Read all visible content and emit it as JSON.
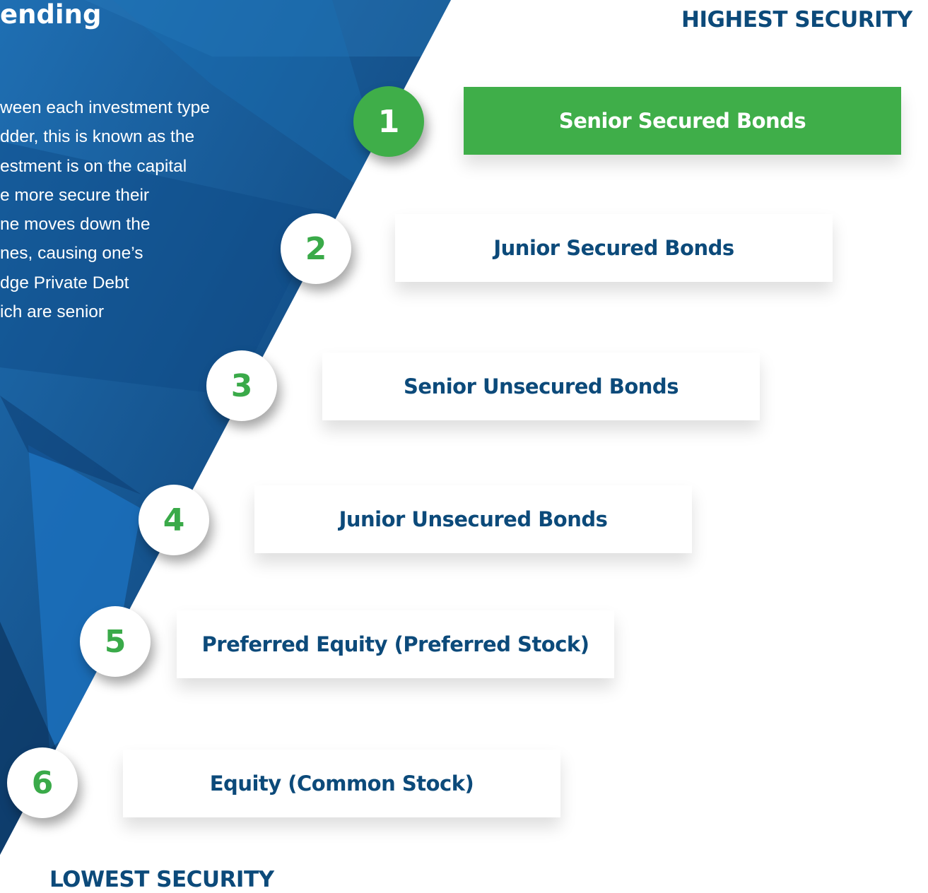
{
  "heading": "ending",
  "paragraph_lines": [
    "ween each investment type",
    "dder, this is known as the",
    "estment is on the capital",
    "e  more  secure  their",
    "ne  moves  down  the",
    "nes, causing one’s",
    "dge Private Debt",
    "ich  are  senior"
  ],
  "top_label": "HIGHEST SECURITY",
  "bottom_label": "LOWEST SECURITY",
  "steps": [
    {
      "number": "1",
      "label": "Senior Secured Bonds",
      "highlighted": true
    },
    {
      "number": "2",
      "label": "Junior Secured Bonds",
      "highlighted": false
    },
    {
      "number": "3",
      "label": "Senior Unsecured Bonds",
      "highlighted": false
    },
    {
      "number": "4",
      "label": "Junior Unsecured Bonds",
      "highlighted": false
    },
    {
      "number": "5",
      "label": "Preferred Equity (Preferred Stock)",
      "highlighted": false
    },
    {
      "number": "6",
      "label": "Equity (Common Stock)",
      "highlighted": false
    }
  ],
  "colors": {
    "background_dark": "#0b3a6b",
    "background_mid": "#1668ad",
    "accent_green": "#3fae49",
    "label_blue": "#0c4a7a"
  }
}
